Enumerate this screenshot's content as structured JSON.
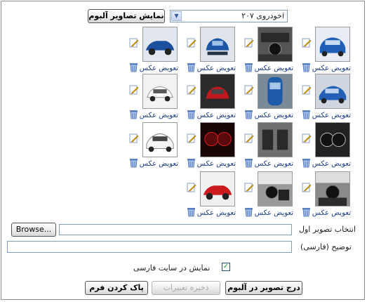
{
  "toolbar": {
    "album_select_value": "خودروی ۲۰۷i",
    "show_album_button": "نمایش تصاویر آلبوم"
  },
  "gallery": {
    "replace_label": "تعویض عکس",
    "items": [
      {
        "subject": "blue hatchback front"
      },
      {
        "subject": "interior dashboard"
      },
      {
        "subject": "blue hatchback rear"
      },
      {
        "subject": "blue hatchback side"
      },
      {
        "subject": "blue hatchback front 2"
      },
      {
        "subject": "blue car top"
      },
      {
        "subject": "red car rear"
      },
      {
        "subject": "white car rear"
      },
      {
        "subject": "dashboard dials"
      },
      {
        "subject": "interior seats"
      },
      {
        "subject": "red dashboard lights"
      },
      {
        "subject": "white car front"
      },
      {
        "subject": "interior front"
      },
      {
        "subject": "interior front 2"
      },
      {
        "subject": "red car side"
      }
    ]
  },
  "form": {
    "browse_button": "Browse...",
    "first_image_label": "انتخاب تصویر اول",
    "description_label": "توضیح (فارسی)",
    "show_on_site_label": "نمایش در سایت فارسی",
    "show_on_site_checked": true,
    "insert_button": "درج تصویر در آلبوم",
    "save_button": "ذخیره تغییرات",
    "clear_button": "پاک کردن فرم"
  }
}
